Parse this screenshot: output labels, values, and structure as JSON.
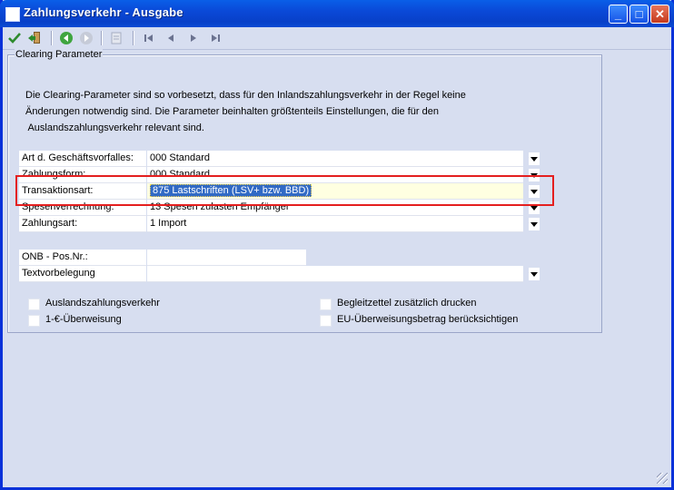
{
  "window": {
    "title": "Zahlungsverkehr - Ausgabe",
    "min_glyph": "_",
    "max_glyph": "□",
    "close_glyph": "✕"
  },
  "toolbar": {
    "icons": [
      "check-icon",
      "exit-icon",
      "back-icon",
      "forward-icon",
      "document-icon",
      "first-record-icon",
      "previous-record-icon",
      "next-record-icon",
      "last-record-icon"
    ]
  },
  "group": {
    "legend": "Clearing Parameter",
    "description": [
      "Die Clearing-Parameter sind so vorbesetzt, dass für den Inlandszahlungsverkehr in der Regel keine",
      "Änderungen notwendig sind. Die Parameter beinhalten größtenteils Einstellungen, die für den",
      " Auslandszahlungsverkehr relevant sind."
    ]
  },
  "fields": {
    "art": {
      "label": "Art d. Geschäftsvorfalles:",
      "value": "000 Standard"
    },
    "zahlungsform": {
      "label": "Zahlungsform:",
      "value": "000 Standard"
    },
    "transaktionsart": {
      "label": "Transaktionsart:",
      "value": "875 Lastschriften (LSV+ bzw. BBD)"
    },
    "spesen": {
      "label": "Spesenverrechnung:",
      "value": "13  Spesen zulasten Empfänger"
    },
    "zahlungsart": {
      "label": "Zahlungsart:",
      "value": "1 Import"
    },
    "onb": {
      "label": "ONB - Pos.Nr.:",
      "value": ""
    },
    "textvorbelegung": {
      "label": "Textvorbelegung",
      "value": ""
    }
  },
  "checkboxes": {
    "ausland": {
      "label": "Auslandszahlungsverkehr",
      "checked": false
    },
    "euro": {
      "label": "1-€-Überweisung",
      "checked": false
    },
    "begleit": {
      "label": "Begleitzettel zusätzlich drucken",
      "checked": false
    },
    "eu": {
      "label": "EU-Überweisungsbetrag berücksichtigen",
      "checked": false
    }
  },
  "colors": {
    "title_bar": "#0A4BD4",
    "selection": "#316AC5",
    "highlight_frame": "#E41F1F",
    "panel": "#D7DEF0"
  }
}
